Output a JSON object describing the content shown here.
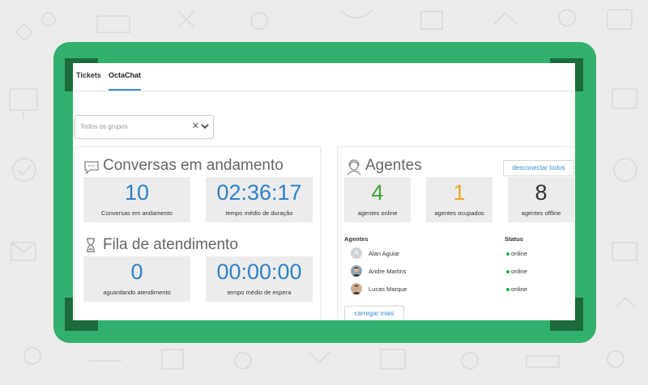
{
  "tabs": [
    {
      "label": "Tickets"
    },
    {
      "label": "OctaChat"
    }
  ],
  "group_filter": {
    "placeholder": "Todos os grupos"
  },
  "conversations": {
    "title": "Conversas em andamento",
    "icon": "chat-bubble-icon",
    "stats": [
      {
        "value": "10",
        "label": "Conversas em andamento"
      },
      {
        "value": "02:36:17",
        "label": "tempo médio de duração"
      }
    ]
  },
  "queue": {
    "title": "Fila de atendimento",
    "icon": "hourglass-icon",
    "stats": [
      {
        "value": "0",
        "label": "aguardando atendimento"
      },
      {
        "value": "00:00:00",
        "label": "tempo médio de espera"
      }
    ]
  },
  "agents": {
    "title": "Agentes",
    "icon": "agent-headset-icon",
    "disconnect_label": "desconectar todos",
    "stats": [
      {
        "value": "4",
        "label": "agentes online",
        "color": "#3fa535"
      },
      {
        "value": "1",
        "label": "agentes ocupados",
        "color": "#f0a623"
      },
      {
        "value": "8",
        "label": "agentes offline",
        "color": "#333333"
      }
    ],
    "columns": {
      "agent": "Agentes",
      "status": "Status"
    },
    "list": [
      {
        "name": "Alan Aguiar",
        "status": "online",
        "avatar_initial": "A"
      },
      {
        "name": "Andre Martins",
        "status": "online",
        "avatar_initial": ""
      },
      {
        "name": "Lucas Marque",
        "status": "online",
        "avatar_initial": ""
      }
    ],
    "load_more_label": "carregar mais"
  },
  "colors": {
    "frame": "#32b06d",
    "corner": "#1d6b3d",
    "accent_blue": "#2d82c9",
    "status_online": "#22b04b"
  }
}
